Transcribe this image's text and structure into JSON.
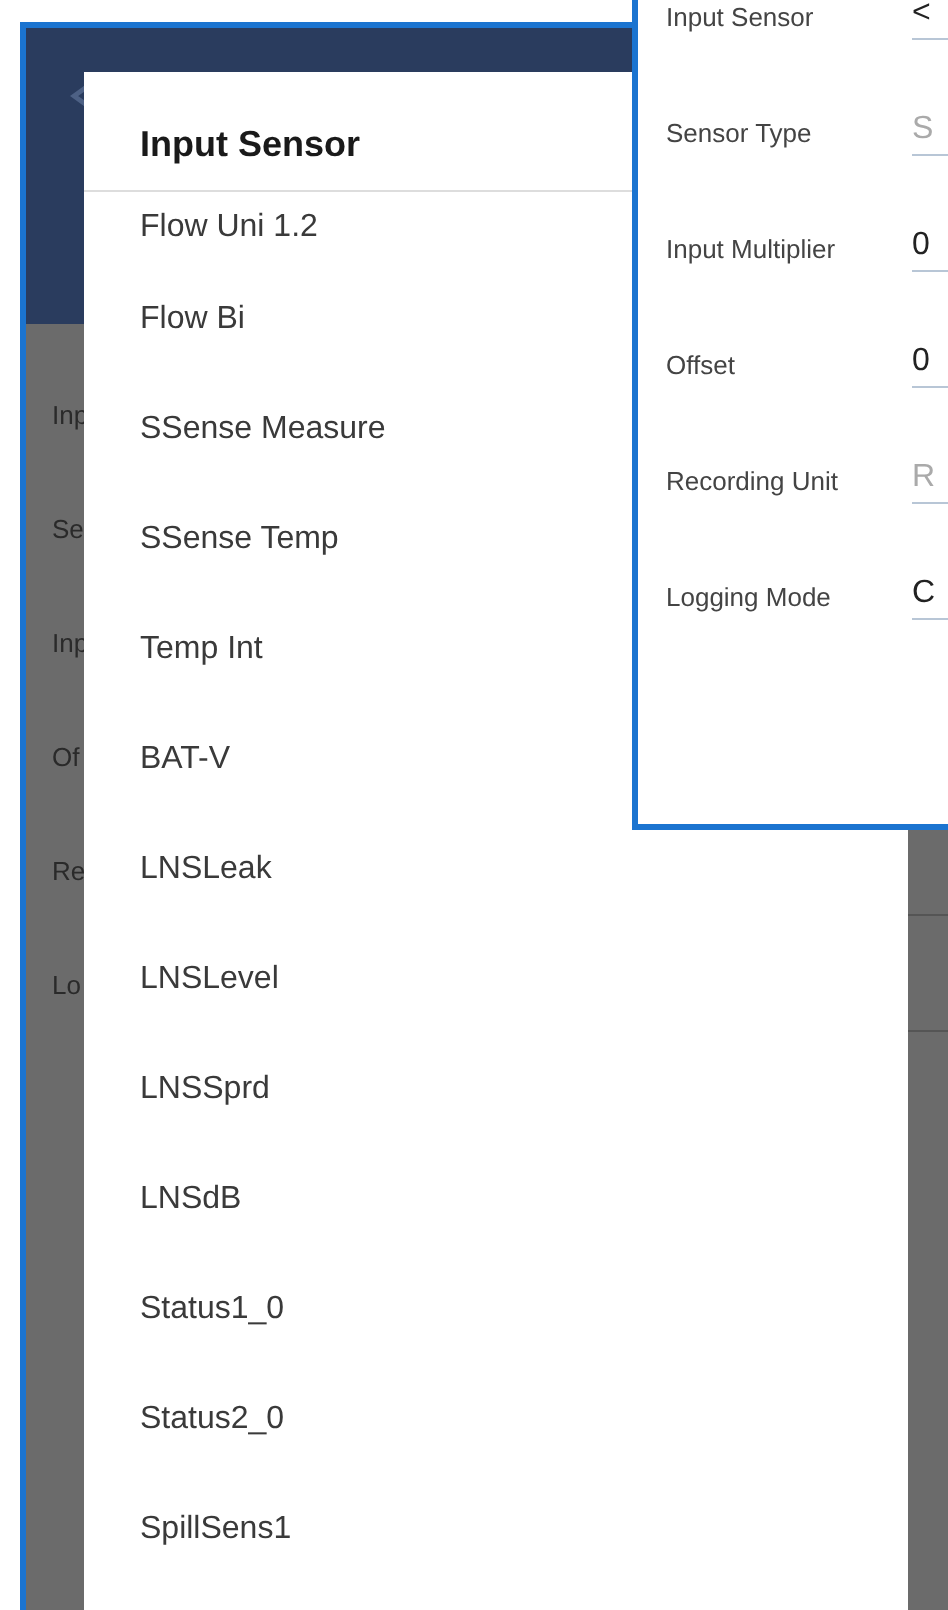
{
  "background_form": {
    "labels": [
      "Inp",
      "Se",
      "Inp",
      "Of",
      "Re",
      "Lo"
    ]
  },
  "dialog": {
    "title": "Input Sensor",
    "items": [
      {
        "label": "Flow Uni 1.2"
      },
      {
        "label": "Flow Bi"
      },
      {
        "label": "SSense Measure"
      },
      {
        "label": "SSense Temp"
      },
      {
        "label": "Temp Int"
      },
      {
        "label": "BAT-V"
      },
      {
        "label": "LNSLeak"
      },
      {
        "label": "LNSLevel"
      },
      {
        "label": "LNSSprd"
      },
      {
        "label": "LNSdB"
      },
      {
        "label": "Status1_0"
      },
      {
        "label": "Status2_0"
      },
      {
        "label": "SpillSens1"
      }
    ]
  },
  "inset_form": {
    "fields": [
      {
        "label": "Input Sensor",
        "value": "<"
      },
      {
        "label": "Sensor Type",
        "placeholder": "S"
      },
      {
        "label": "Input Multiplier",
        "value": "0"
      },
      {
        "label": "Offset",
        "value": "0"
      },
      {
        "label": "Recording Unit",
        "placeholder": "R"
      },
      {
        "label": "Logging Mode",
        "value": "C"
      }
    ]
  }
}
